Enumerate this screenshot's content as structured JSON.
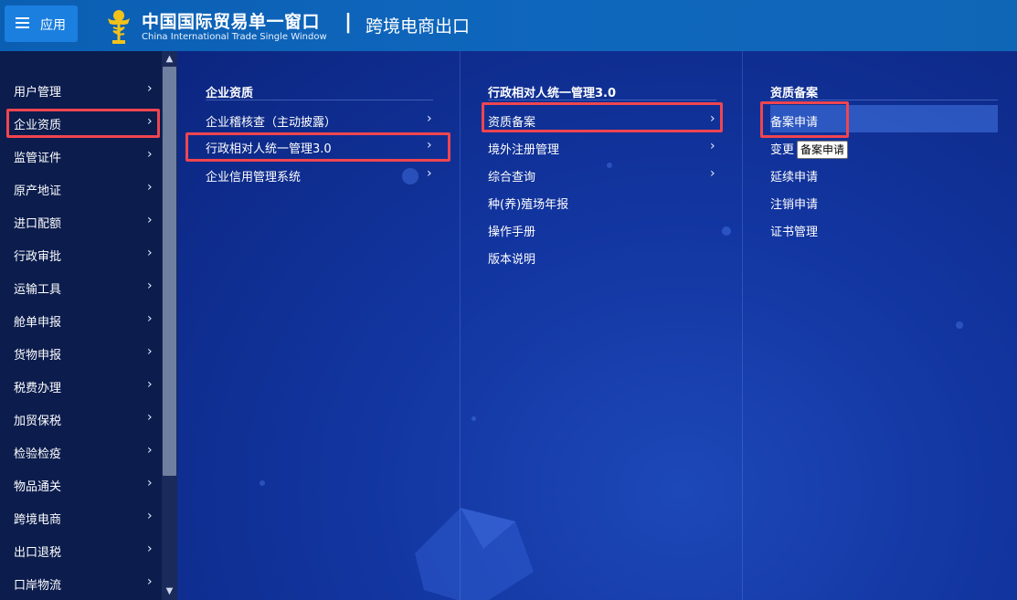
{
  "header": {
    "app_label": "应用",
    "brand_cn": "中国国际贸易单一窗口",
    "brand_en": "China International Trade Single Window",
    "separator": "|",
    "channel_title": "跨境电商出口"
  },
  "sidebar": {
    "items": [
      {
        "label": "用户管理"
      },
      {
        "label": "企业资质",
        "active": true
      },
      {
        "label": "监管证件"
      },
      {
        "label": "原产地证"
      },
      {
        "label": "进口配额"
      },
      {
        "label": "行政审批"
      },
      {
        "label": "运输工具"
      },
      {
        "label": "舱单申报"
      },
      {
        "label": "货物申报"
      },
      {
        "label": "税费办理"
      },
      {
        "label": "加贸保税"
      },
      {
        "label": "检验检疫"
      },
      {
        "label": "物品通关"
      },
      {
        "label": "跨境电商"
      },
      {
        "label": "出口退税"
      },
      {
        "label": "口岸物流"
      }
    ]
  },
  "columns": {
    "col1": {
      "heading": "企业资质",
      "items": [
        {
          "label": "企业稽核查（主动披露）"
        },
        {
          "label": "行政相对人统一管理3.0",
          "highlighted": true
        },
        {
          "label": "企业信用管理系统"
        }
      ]
    },
    "col2": {
      "heading": "行政相对人统一管理3.0",
      "items": [
        {
          "label": "资质备案",
          "highlighted": true
        },
        {
          "label": "境外注册管理"
        },
        {
          "label": "综合查询"
        },
        {
          "label": "种(养)殖场年报"
        },
        {
          "label": "操作手册"
        },
        {
          "label": "版本说明"
        }
      ]
    },
    "col3": {
      "heading": "资质备案",
      "items": [
        {
          "label": "备案申请",
          "highlighted": true
        },
        {
          "label": "变更"
        },
        {
          "label": "延续申请"
        },
        {
          "label": "注销申请"
        },
        {
          "label": "证书管理"
        }
      ]
    }
  },
  "tooltip": {
    "text": "备案申请"
  },
  "icons": {
    "menu": "hamburger-icon",
    "logo": "customs-emblem-icon",
    "chevron": "chevron-right-icon",
    "scroll_up": "triangle-up-icon",
    "scroll_down": "triangle-down-icon"
  },
  "colors": {
    "header": "#0f67bd",
    "sidebar": "#0b1c4d",
    "main": "#1235a0",
    "highlight_border": "#f0454f",
    "app_button": "#1b7fe0"
  }
}
